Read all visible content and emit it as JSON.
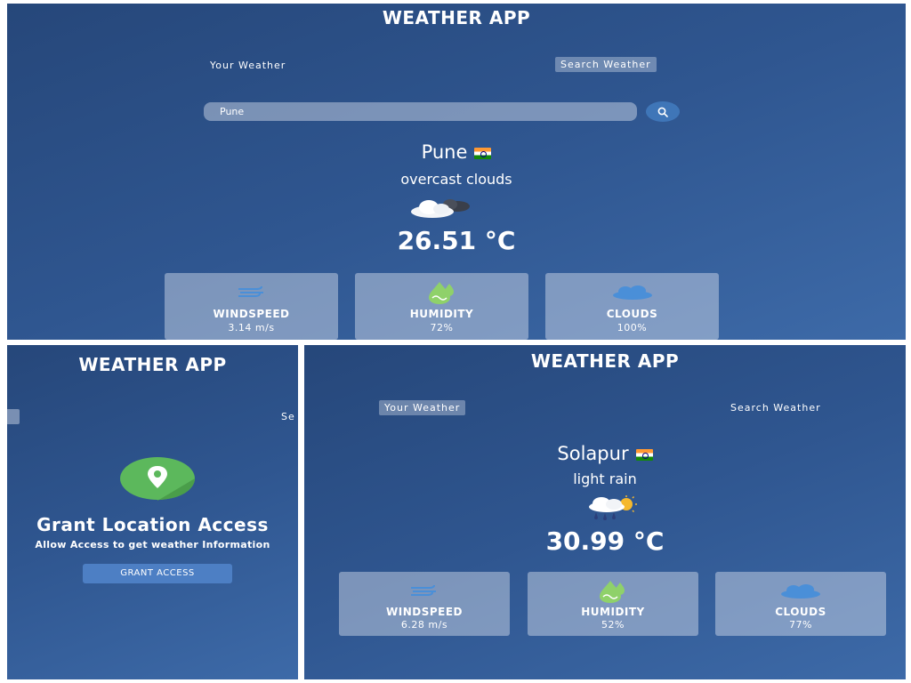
{
  "app_title": "WEATHER APP",
  "top_view": {
    "tab_your_weather": "Your Weather",
    "tab_search_weather": "Search Weather",
    "search_value": "Pune",
    "city": "Pune",
    "description": "overcast clouds",
    "temperature": "26.51 °C",
    "cards": {
      "windspeed_label": "WINDSPEED",
      "windspeed_value": "3.14 m/s",
      "humidity_label": "HUMIDITY",
      "humidity_value": "72%",
      "clouds_label": "CLOUDS",
      "clouds_value": "100%"
    }
  },
  "grant_view": {
    "tab_fragment": "Se",
    "heading": "Grant Location Access",
    "subtext": "Allow Access to get weather Information",
    "button": "GRANT ACCESS"
  },
  "bottom_view": {
    "tab_your_weather": "Your Weather",
    "tab_search_weather": "Search Weather",
    "city": "Solapur",
    "description": "light rain",
    "temperature": "30.99 °C",
    "cards": {
      "windspeed_label": "WINDSPEED",
      "windspeed_value": "6.28 m/s",
      "humidity_label": "HUMIDITY",
      "humidity_value": "52%",
      "clouds_label": "CLOUDS",
      "clouds_value": "77%"
    }
  },
  "icons": {
    "search": "search-icon",
    "weather_top": "overcast-cloud-icon",
    "weather_bottom": "rain-sun-cloud-icon",
    "wind": "wind-icon",
    "humidity": "humidity-drop-icon",
    "clouds": "cloud-icon",
    "location": "location-pin-icon",
    "flag": "india-flag-icon"
  },
  "colors": {
    "background_top": "#26477a",
    "background_bottom": "#3d6aa8",
    "card": "#dbe2ef",
    "accent_button": "#3f76b8",
    "location_green": "#5cb85c"
  }
}
